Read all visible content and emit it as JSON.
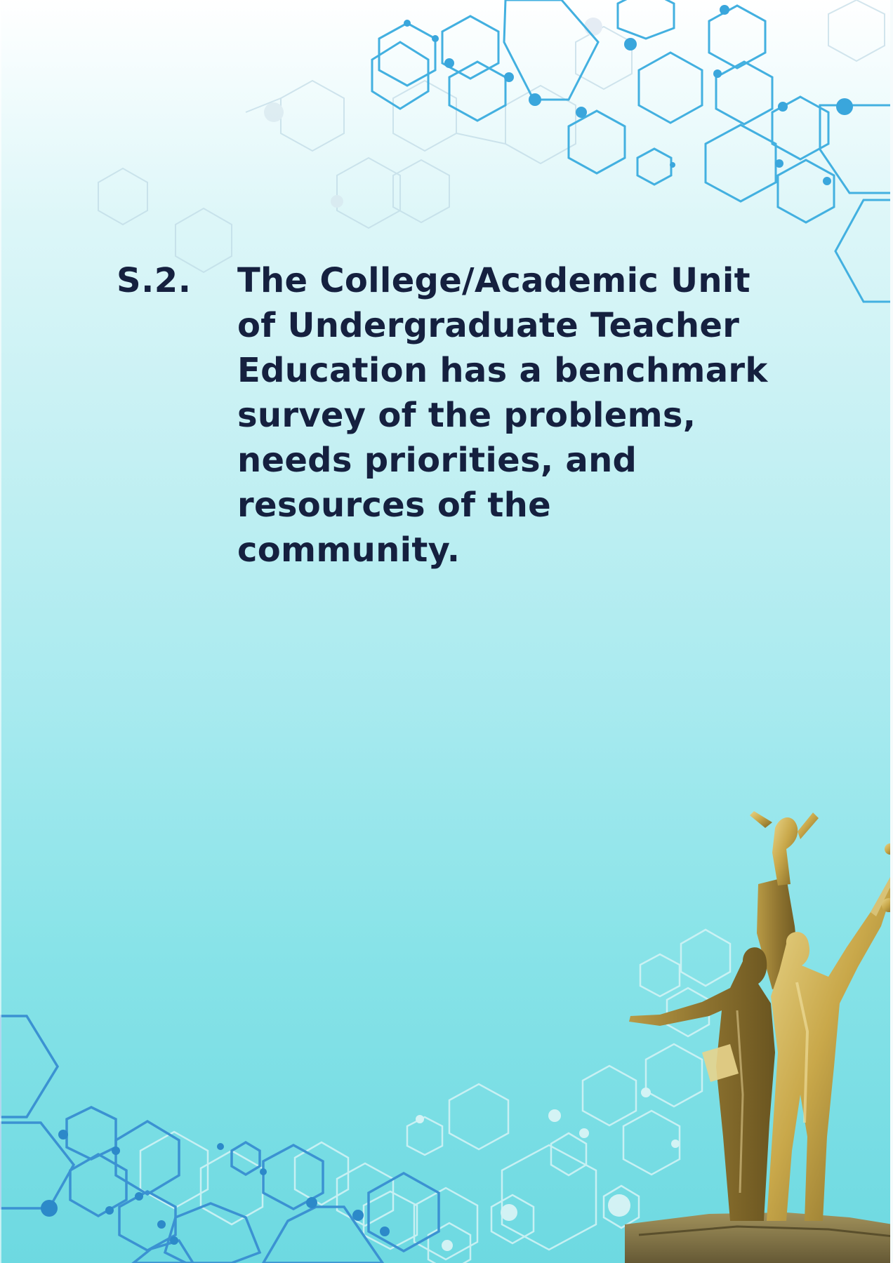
{
  "statement": {
    "code": "S.2.",
    "text": "The College/Academic Unit of Undergraduate Teacher Education has a benchmark survey of the problems, needs priorities, and resources of the community."
  },
  "colors": {
    "text": "#15203f",
    "hex_line": "#3aa7dc",
    "hex_light": "#b5dbe6",
    "statue_gold": "#c9a84a"
  },
  "decorations": {
    "top_pattern": "hexagon-network-pattern",
    "bottom_pattern": "hexagon-network-pattern",
    "statue": "golden-monument-statue"
  }
}
